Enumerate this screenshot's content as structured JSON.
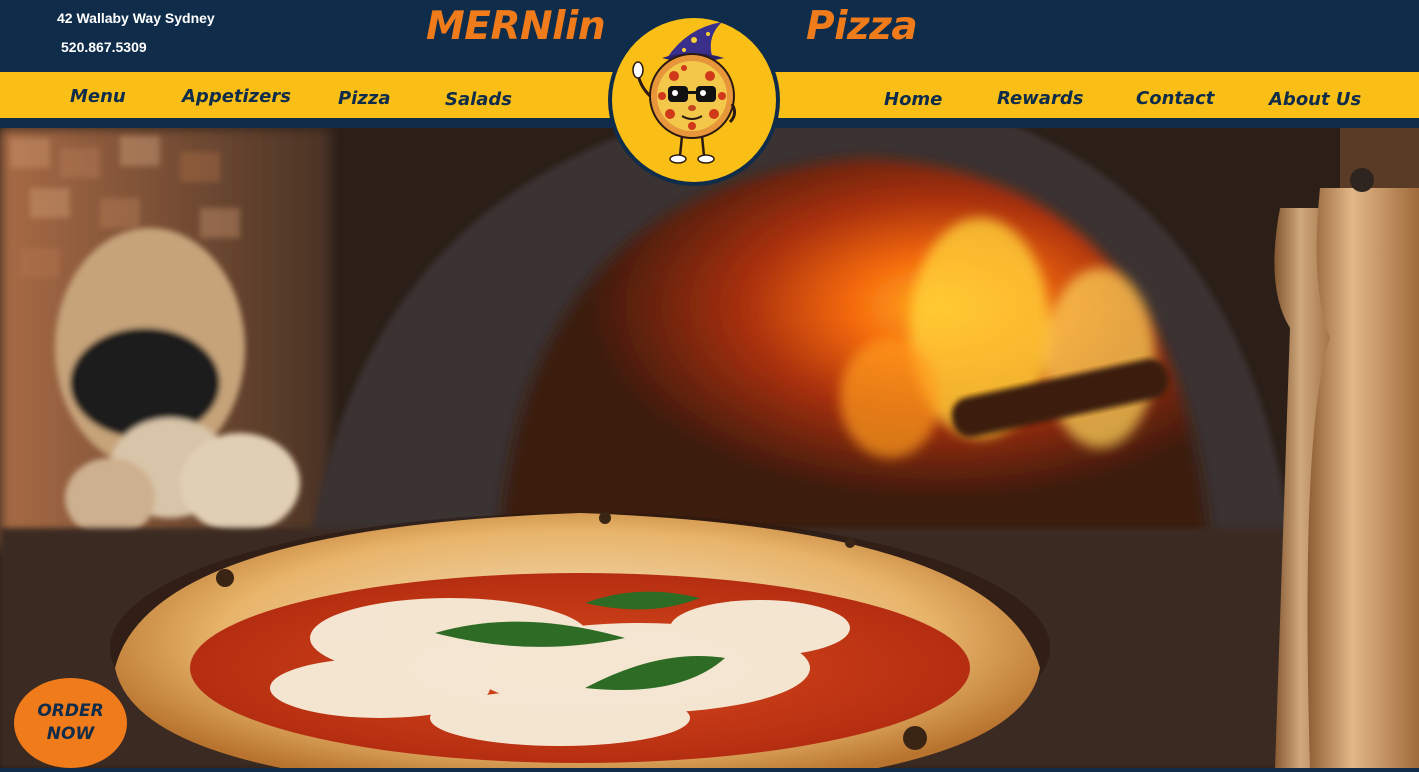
{
  "header": {
    "address": "42 Wallaby Way Sydney",
    "phone": "520.867.5309",
    "brand_left": "MERNlin",
    "brand_right": "Pizza",
    "logo_icon": "wizard-pizza-mascot-icon"
  },
  "nav": {
    "left": [
      {
        "label": "Menu"
      },
      {
        "label": "Appetizers"
      },
      {
        "label": "Pizza"
      },
      {
        "label": "Salads"
      }
    ],
    "right": [
      {
        "label": "Home"
      },
      {
        "label": "Rewards"
      },
      {
        "label": "Contact"
      },
      {
        "label": "About Us"
      }
    ]
  },
  "hero": {
    "image": "margherita-pizza-wood-fired-oven-photo"
  },
  "order_button": {
    "line1": "ORDER",
    "line2": "NOW"
  },
  "colors": {
    "navy": "#0f2d4a",
    "yellow": "#f9bf16",
    "orange": "#f07b1a"
  }
}
